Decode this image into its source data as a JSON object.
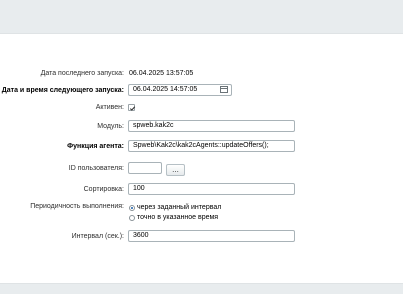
{
  "form": {
    "last_run_label": "Дата последнего запуска:",
    "last_run_value": "06.04.2025 13:57:05",
    "next_run_label": "Дата и время следующего запуска:",
    "next_run_value": "06.04.2025 14:57:05",
    "active_label": "Активен:",
    "active_checked": true,
    "module_label": "Модуль:",
    "module_value": "spweb.kak2c",
    "function_label": "Функция агента:",
    "function_value": "Spweb\\Kak2c\\kak2cAgents::updateOffers();",
    "user_id_label": "ID пользователя:",
    "user_id_value": "",
    "user_button_label": "...",
    "sort_label": "Сортировка:",
    "sort_value": "100",
    "period_label": "Периодичность выполнения:",
    "period_option_interval": "через заданный интервал",
    "period_option_exact": "точно в указанное время",
    "period_selected": "interval",
    "interval_label": "Интервал (сек.):",
    "interval_value": "3600"
  },
  "colors": {
    "background": "#e8ecee",
    "panel": "#ffffff",
    "field_border": "#a9b3b8",
    "radio_accent": "#1a5ea8"
  }
}
